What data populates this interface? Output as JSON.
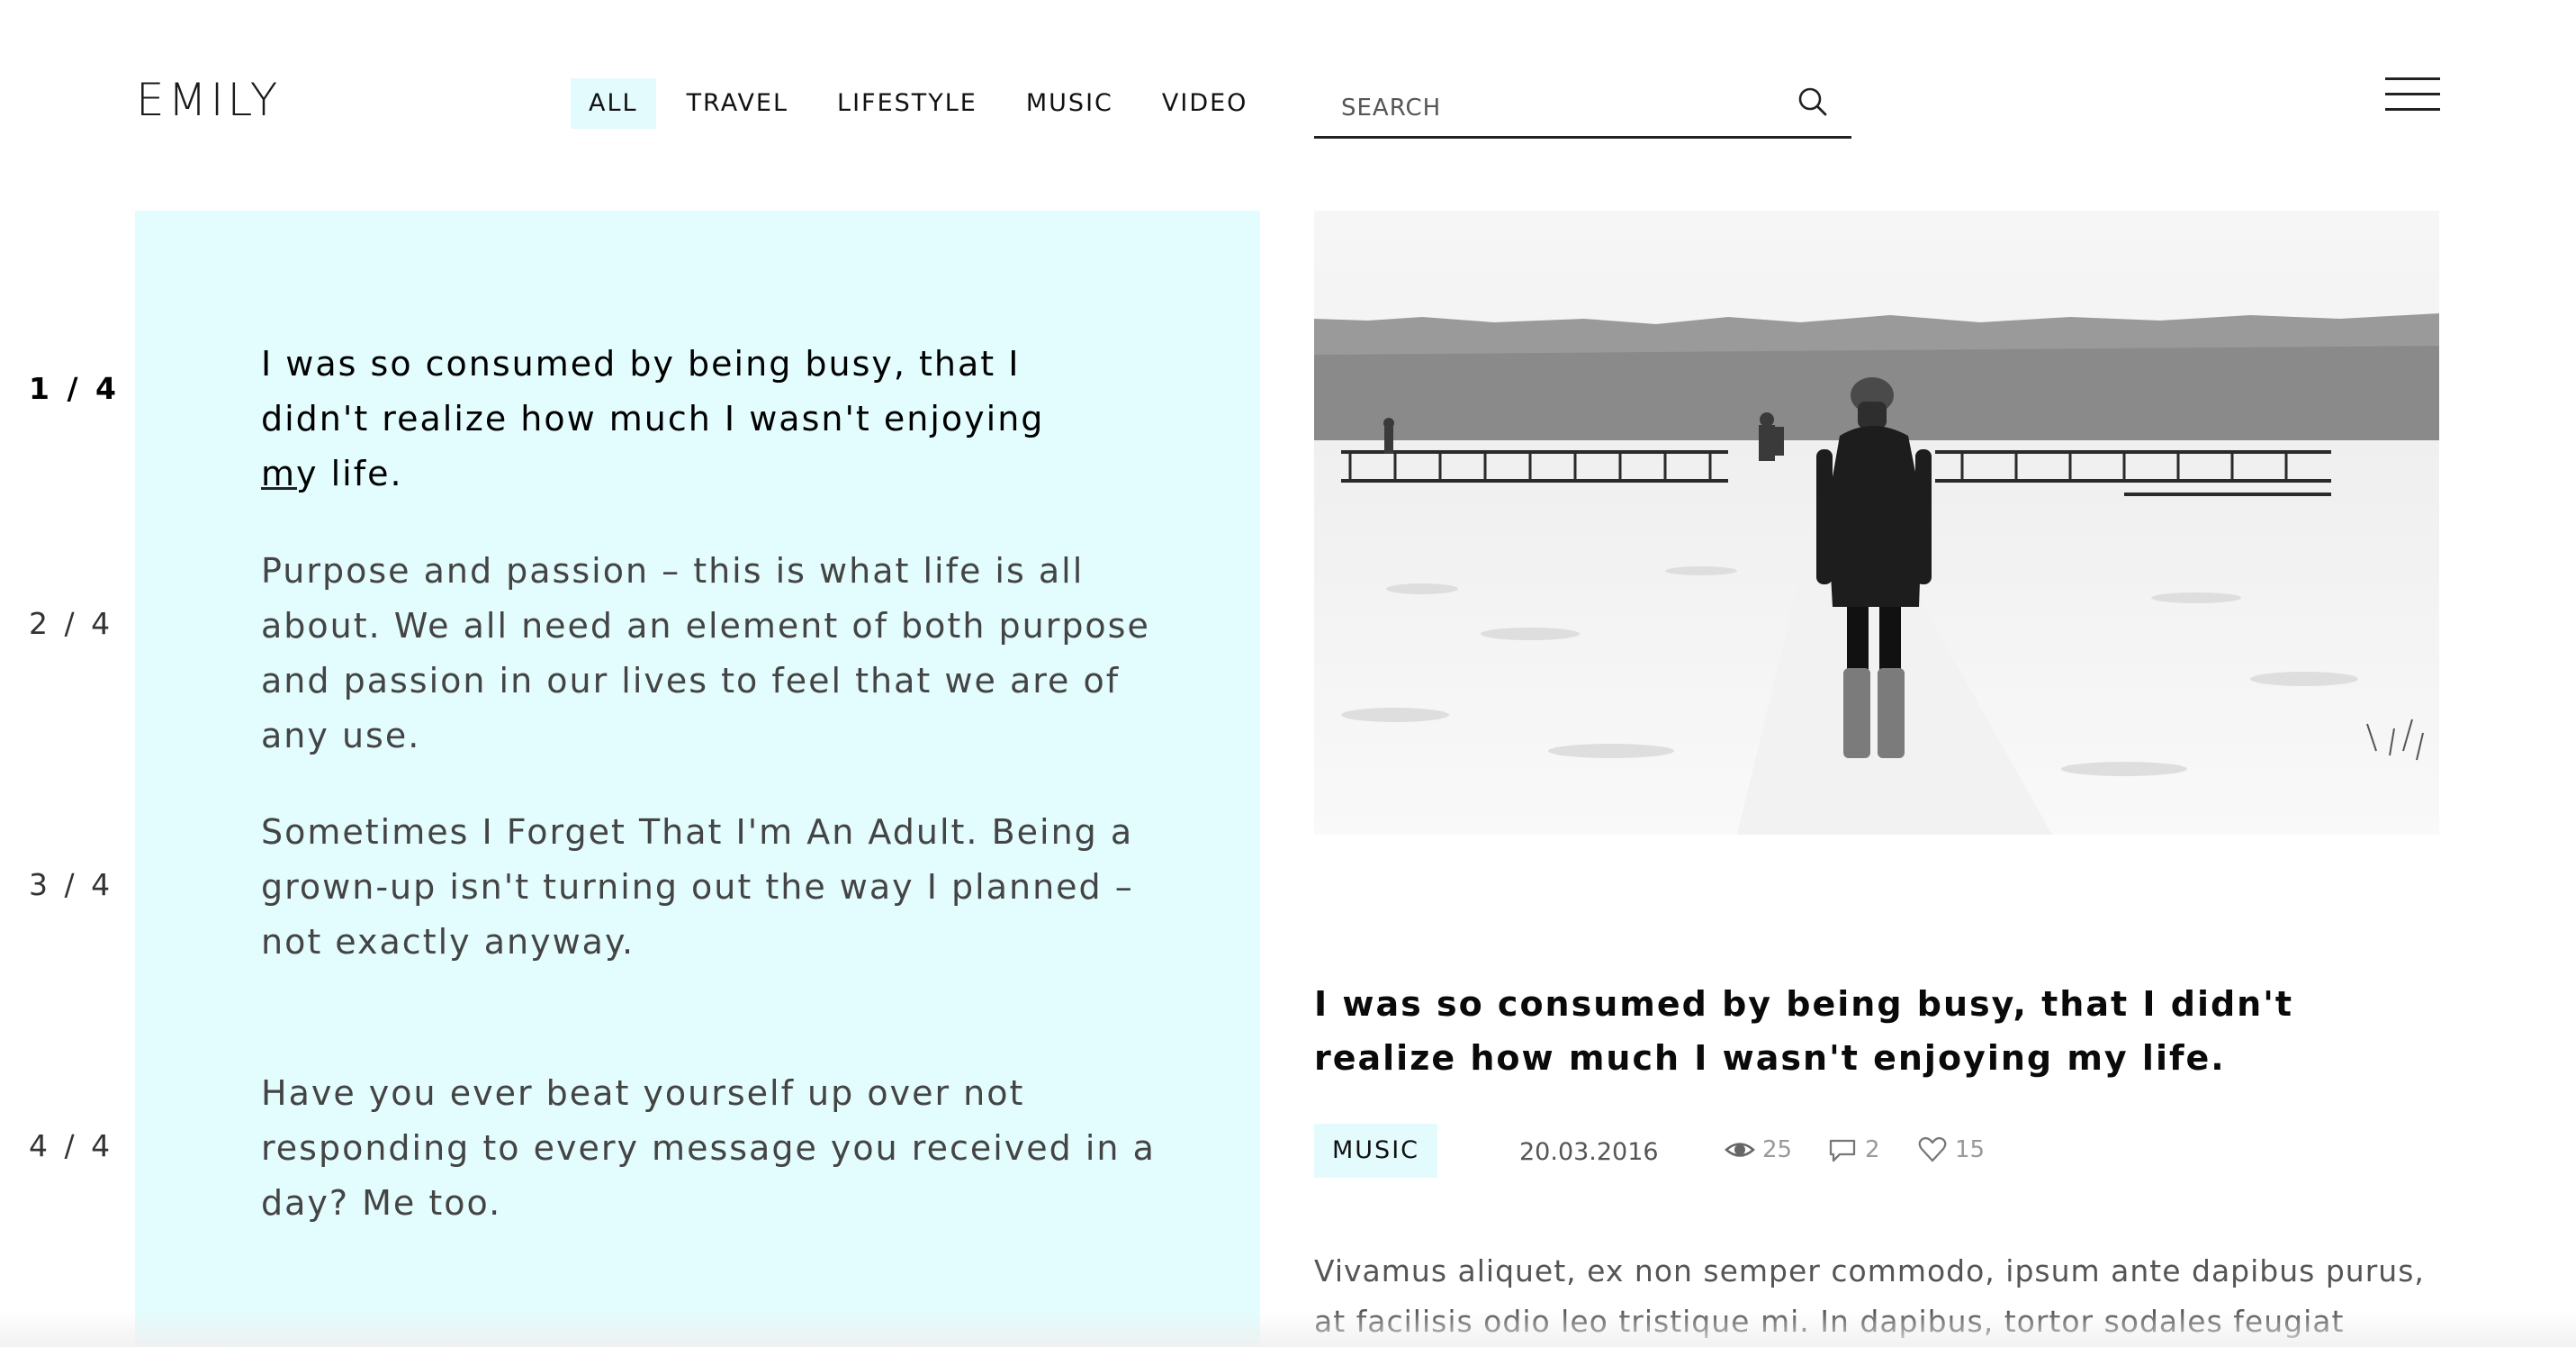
{
  "header": {
    "logo": "EMILY",
    "nav": [
      {
        "label": "ALL",
        "active": true
      },
      {
        "label": "TRAVEL",
        "active": false
      },
      {
        "label": "LIFESTYLE",
        "active": false
      },
      {
        "label": "MUSIC",
        "active": false
      },
      {
        "label": "VIDEO",
        "active": false
      }
    ],
    "search": {
      "placeholder": "SEARCH",
      "value": ""
    }
  },
  "quotes": {
    "items": [
      {
        "counter": "1 / 4",
        "text": "I was so consumed by being busy, that I didn't realize how much I wasn't enjoying my life.",
        "active": true
      },
      {
        "counter": "2 / 4",
        "text": "Purpose and passion – this is what life is all about. We all need an element of both purpose and passion in our lives to feel that we are of any use.",
        "active": false
      },
      {
        "counter": "3 / 4",
        "text": "Sometimes I Forget That I'm An Adult. Being a grown-up isn't turning out the way I planned – not exactly anyway.",
        "active": false
      },
      {
        "counter": "4 / 4",
        "text": "Have you ever beat yourself up over not responding to every message you received in a day? Me too.",
        "active": false
      }
    ]
  },
  "post": {
    "title": "I was so consumed by being busy, that I didn't realize how much I wasn't enjoying my life.",
    "tag": "MUSIC",
    "date": "20.03.2016",
    "views": "25",
    "comments": "2",
    "likes": "15",
    "excerpt": "Vivamus aliquet, ex non semper commodo, ipsum ante dapibus purus, at facilisis odio leo tristique mi. In dapibus, tortor sodales feugiat ultrices, dolor"
  },
  "colors": {
    "accent": "#e3fcfd",
    "text": "#111111",
    "muted": "#999999"
  },
  "icons": [
    "search-icon",
    "hamburger-menu-icon",
    "eye-icon",
    "comment-icon",
    "heart-icon"
  ]
}
